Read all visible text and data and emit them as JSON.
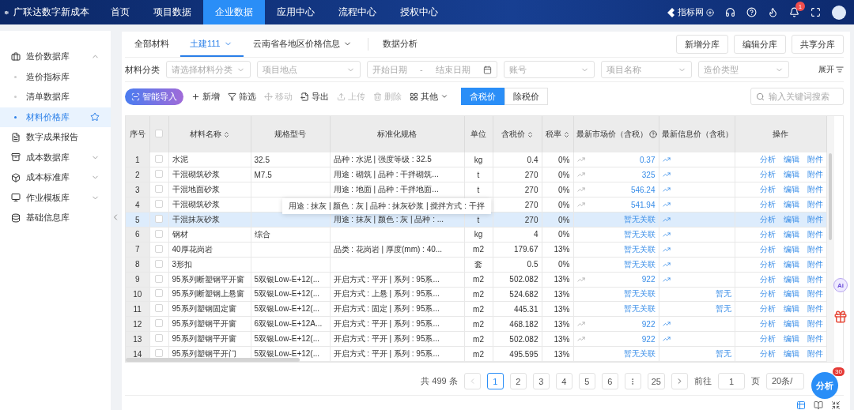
{
  "brand": {
    "title": "广联达数字新成本"
  },
  "nav": [
    {
      "label": "首页",
      "selected": false
    },
    {
      "label": "项目数据",
      "selected": false
    },
    {
      "label": "企业数据",
      "selected": true
    },
    {
      "label": "应用中心",
      "selected": false
    },
    {
      "label": "流程中心",
      "selected": false
    },
    {
      "label": "授权中心",
      "selected": false
    }
  ],
  "header_right": {
    "site_link": "指标网",
    "notification_count": "1"
  },
  "sidebar": {
    "items": [
      {
        "label": "造价数据库",
        "expanded": true,
        "children": [
          {
            "label": "造价指标库",
            "selected": false,
            "starred": false
          },
          {
            "label": "清单数据库",
            "selected": false,
            "starred": false
          },
          {
            "label": "材料价格库",
            "selected": true,
            "starred": true
          }
        ]
      },
      {
        "label": "数字成果报告"
      },
      {
        "label": "成本数据库",
        "expanded": false
      },
      {
        "label": "成本标准库",
        "expanded": false
      },
      {
        "label": "作业模板库",
        "expanded": false
      },
      {
        "label": "基础信息库"
      }
    ]
  },
  "tabs": [
    {
      "label": "全部材料",
      "selected": false,
      "dropdown": false
    },
    {
      "label": "土建111",
      "selected": true,
      "dropdown": true
    },
    {
      "label": "云南省各地区价格信息",
      "selected": false,
      "dropdown": true
    },
    {
      "label": "数据分析",
      "selected": false,
      "dropdown": false
    }
  ],
  "library_buttons": [
    "新增分库",
    "编辑分库",
    "共享分库"
  ],
  "filters": {
    "label": "材料分类",
    "category": {
      "placeholder": "请选择材料分类"
    },
    "location": {
      "placeholder": "项目地点"
    },
    "start_date": {
      "placeholder": "开始日期"
    },
    "date_separator": "-",
    "end_date": {
      "placeholder": "结束日期"
    },
    "account": {
      "placeholder": "账号"
    },
    "project": {
      "placeholder": "项目名称"
    },
    "cost_type": {
      "placeholder": "造价类型"
    },
    "expand": "展开"
  },
  "toolbar": [
    {
      "label": "智能导入",
      "kind": "primary",
      "disabled": false
    },
    {
      "label": "新增",
      "kind": "action",
      "disabled": false
    },
    {
      "label": "筛选",
      "kind": "action",
      "disabled": false
    },
    {
      "label": "移动",
      "kind": "action",
      "disabled": true
    },
    {
      "label": "导出",
      "kind": "action",
      "disabled": false
    },
    {
      "label": "上传",
      "kind": "action",
      "disabled": true
    },
    {
      "label": "删除",
      "kind": "action",
      "disabled": true
    },
    {
      "label": "其他",
      "kind": "menu",
      "disabled": false
    }
  ],
  "price_mode": [
    {
      "label": "含税价",
      "selected": true
    },
    {
      "label": "除税价",
      "selected": false
    }
  ],
  "search": {
    "placeholder": "输入关键词搜索"
  },
  "table": {
    "columns": [
      {
        "kind": "text",
        "label": "序号",
        "sortable": false,
        "help": false
      },
      {
        "kind": "checkbox",
        "checked": false
      },
      {
        "kind": "text",
        "label": "材料名称",
        "sortable": true,
        "help": false
      },
      {
        "kind": "text",
        "label": "规格型号",
        "sortable": false,
        "help": false
      },
      {
        "kind": "text",
        "label": "标准化规格",
        "sortable": false,
        "help": false
      },
      {
        "kind": "text",
        "label": "单位",
        "sortable": false,
        "help": false
      },
      {
        "kind": "text",
        "label": "含税价",
        "sortable": true,
        "help": false
      },
      {
        "kind": "text",
        "label": "税率",
        "sortable": true,
        "help": false
      },
      {
        "kind": "text",
        "label": "最新市场价（含税）",
        "sortable": false,
        "help": true
      },
      {
        "kind": "text",
        "label": "最新信息价（含税）",
        "sortable": false,
        "help": false
      },
      {
        "kind": "text",
        "label": "操作",
        "sortable": false,
        "help": false
      }
    ],
    "rows": [
      {
        "no": "1",
        "checked": false,
        "selected": false,
        "name": "水泥",
        "spec": "32.5",
        "std": "品种 : 水泥 | 强度等级 : 32.5",
        "unit": "kg",
        "price": "0.4",
        "tax": "0%",
        "market": {
          "trend": true,
          "text": "0.37"
        },
        "info": {
          "trend": true
        },
        "actions": [
          "分析",
          "编辑",
          "附件"
        ]
      },
      {
        "no": "2",
        "checked": false,
        "selected": false,
        "name": "干混砌筑砂浆",
        "spec": "M7.5",
        "std": "用途 : 砌筑 | 品种 : 干拌砌筑...",
        "unit": "t",
        "price": "270",
        "tax": "0%",
        "market": {
          "trend": true,
          "text": "325"
        },
        "info": {
          "trend": true
        },
        "actions": [
          "分析",
          "编辑",
          "附件"
        ]
      },
      {
        "no": "3",
        "checked": false,
        "selected": false,
        "name": "干混地面砂浆",
        "std": "用途 : 地面 | 品种 : 干拌地面...",
        "unit": "t",
        "price": "270",
        "tax": "0%",
        "market": {
          "trend": true,
          "text": "546.24"
        },
        "info": {
          "trend": true
        },
        "actions": [
          "分析",
          "编辑",
          "附件"
        ]
      },
      {
        "no": "4",
        "checked": false,
        "selected": false,
        "name": "干混砌筑砂浆",
        "price": "270",
        "tax": "0%",
        "market": {
          "trend": true,
          "text": "541.94"
        },
        "info": {
          "trend": true
        },
        "actions": [
          "分析",
          "编辑",
          "附件"
        ],
        "tooltip": "用途 : 抹灰 | 颜色 : 灰 | 品种 : 抹灰砂浆 | 搅拌方式 : 干拌"
      },
      {
        "no": "5",
        "checked": false,
        "selected": true,
        "name": "干混抹灰砂浆",
        "std": "用途 : 抹灰 | 颜色 : 灰 | 品种 : ...",
        "unit": "t",
        "price": "270",
        "tax": "0%",
        "market": {
          "trend": false,
          "text": "暂无关联"
        },
        "info": {
          "trend": true
        },
        "actions": [
          "分析",
          "编辑",
          "附件"
        ]
      },
      {
        "no": "6",
        "checked": false,
        "selected": false,
        "name": "钢材",
        "spec": "综合",
        "unit": "kg",
        "price": "4",
        "tax": "0%",
        "market": {
          "trend": false,
          "text": "暂无关联"
        },
        "info": {
          "trend": true
        },
        "actions": [
          "分析",
          "编辑",
          "附件"
        ]
      },
      {
        "no": "7",
        "checked": false,
        "selected": false,
        "name": "40厚花岗岩",
        "std": "品类 : 花岗岩 | 厚度(mm) : 40...",
        "unit": "m2",
        "price": "179.67",
        "tax": "13%",
        "market": {
          "trend": false,
          "text": "暂无关联"
        },
        "info": {
          "trend": true
        },
        "actions": [
          "分析",
          "编辑",
          "附件"
        ]
      },
      {
        "no": "8",
        "checked": false,
        "selected": false,
        "name": "3形扣",
        "unit": "套",
        "price": "0.5",
        "tax": "0%",
        "market": {
          "trend": false,
          "text": "暂无关联"
        },
        "info": {
          "trend": true
        },
        "actions": [
          "分析",
          "编辑",
          "附件"
        ]
      },
      {
        "no": "9",
        "checked": false,
        "selected": false,
        "name": "95系列断塑钢平开窗",
        "spec": "5双银Low-E+12(...",
        "std": "开启方式 : 平开 | 系列 : 95系...",
        "unit": "m2",
        "price": "502.082",
        "tax": "13%",
        "market": {
          "trend": true,
          "text": "922"
        },
        "info": {
          "trend": true
        },
        "actions": [
          "分析",
          "编辑",
          "附件"
        ]
      },
      {
        "no": "10",
        "checked": false,
        "selected": false,
        "name": "95系列断塑钢上悬窗",
        "spec": "5双银Low-E+12(...",
        "std": "开启方式 : 上悬 | 系列 : 95系...",
        "unit": "m2",
        "price": "524.682",
        "tax": "13%",
        "market": {
          "trend": false,
          "text": "暂无关联"
        },
        "info": {
          "trend": false,
          "text": "暂无"
        },
        "actions": [
          "分析",
          "编辑",
          "附件"
        ]
      },
      {
        "no": "11",
        "checked": false,
        "selected": false,
        "name": "95系列塑钢固定窗",
        "spec": "5双银Low-E+12(...",
        "std": "开启方式 : 固定 | 系列 : 95系...",
        "unit": "m2",
        "price": "445.31",
        "tax": "13%",
        "market": {
          "trend": false,
          "text": "暂无关联"
        },
        "info": {
          "trend": false,
          "text": "暂无"
        },
        "actions": [
          "分析",
          "编辑",
          "附件"
        ]
      },
      {
        "no": "12",
        "checked": false,
        "selected": false,
        "name": "95系列塑钢平开窗",
        "spec": "6双银Low-E+12A...",
        "std": "开启方式 : 平开 | 系列 : 95系...",
        "unit": "m2",
        "price": "468.182",
        "tax": "13%",
        "market": {
          "trend": true,
          "text": "922"
        },
        "info": {
          "trend": true
        },
        "actions": [
          "分析",
          "编辑",
          "附件"
        ]
      },
      {
        "no": "13",
        "checked": false,
        "selected": false,
        "name": "95系列塑钢平开窗",
        "spec": "5双银Low-E+12(...",
        "std": "开启方式 : 平开 | 系列 : 95系...",
        "unit": "m2",
        "price": "502.082",
        "tax": "13%",
        "market": {
          "trend": true,
          "text": "922"
        },
        "info": {
          "trend": true
        },
        "actions": [
          "分析",
          "编辑",
          "附件"
        ]
      },
      {
        "no": "14",
        "checked": false,
        "selected": false,
        "name": "95系列塑钢平开门",
        "spec": "5双银Low-E+12(...",
        "std": "开启方式 : 平开 | 系列 : 95系...",
        "unit": "m2",
        "price": "495.595",
        "tax": "13%",
        "market": {
          "trend": false,
          "text": "暂无关联"
        },
        "info": {
          "trend": false,
          "text": "暂无"
        },
        "actions": [
          "分析",
          "编辑",
          "附件"
        ]
      }
    ]
  },
  "pagination": {
    "total": "共 499 条",
    "pages": [
      {
        "label": "1",
        "kind": "page",
        "selected": true
      },
      {
        "label": "2",
        "kind": "page",
        "selected": false
      },
      {
        "label": "3",
        "kind": "page",
        "selected": false
      },
      {
        "label": "4",
        "kind": "page",
        "selected": false
      },
      {
        "label": "5",
        "kind": "page",
        "selected": false
      },
      {
        "label": "6",
        "kind": "page",
        "selected": false
      },
      {
        "kind": "more",
        "selected": false
      },
      {
        "label": "25",
        "kind": "page",
        "selected": false
      }
    ],
    "goto_label": "前往",
    "goto_value": "1",
    "page_unit": "页",
    "page_size": "20条/"
  },
  "floating": {
    "ai_label": "Ai",
    "analyze_label": "分析",
    "analyze_count": "30"
  }
}
